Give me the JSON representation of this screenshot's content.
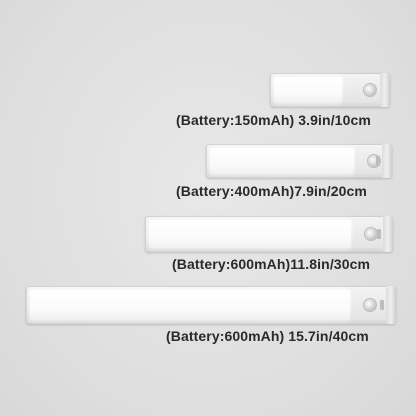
{
  "products": [
    {
      "label": "(Battery:150mAh) 3.9in/10cm"
    },
    {
      "label": "(Battery:400mAh)7.9in/20cm"
    },
    {
      "label": "(Battery:600mAh)11.8in/30cm"
    },
    {
      "label": "(Battery:600mAh) 15.7in/40cm"
    }
  ],
  "colors": {
    "background": "#e2e2e2",
    "light_panel": "#ffffff",
    "text": "#2a2a2a"
  }
}
